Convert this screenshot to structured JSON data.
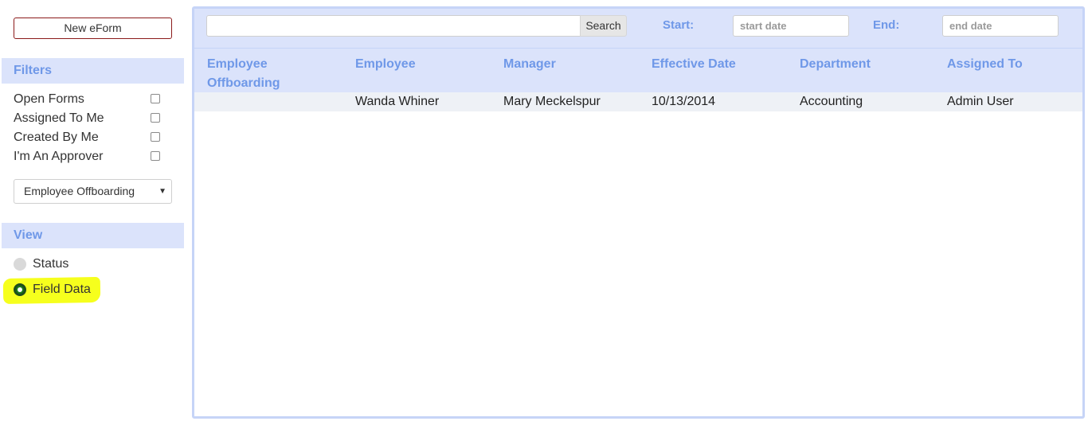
{
  "sidebar": {
    "new_eform_label": "New eForm",
    "filters_title": "Filters",
    "filters": [
      {
        "label": "Open Forms",
        "checked": false
      },
      {
        "label": "Assigned To Me",
        "checked": false
      },
      {
        "label": "Created By Me",
        "checked": false
      },
      {
        "label": "I'm An Approver",
        "checked": false
      }
    ],
    "form_type_selected": "Employee Offboarding",
    "view_title": "View",
    "view_options": [
      {
        "label": "Status",
        "selected": false
      },
      {
        "label": "Field Data",
        "selected": true
      }
    ]
  },
  "toolbar": {
    "search_value": "",
    "search_button_label": "Search",
    "start_label": "Start:",
    "start_placeholder": "start date",
    "end_label": "End:",
    "end_placeholder": "end date"
  },
  "table": {
    "headers": [
      "Employee Offboarding",
      "Employee",
      "Manager",
      "Effective Date",
      "Department",
      "Assigned To"
    ],
    "rows": [
      [
        "",
        "Wanda Whiner",
        "Mary Meckelspur",
        "10/13/2014",
        "Accounting",
        "Admin User"
      ]
    ]
  },
  "colors": {
    "accent": "#6f98e8",
    "header_bg": "#dbe3fb",
    "highlight": "#f6ff1d",
    "radio_selected": "#1a7a1a"
  }
}
